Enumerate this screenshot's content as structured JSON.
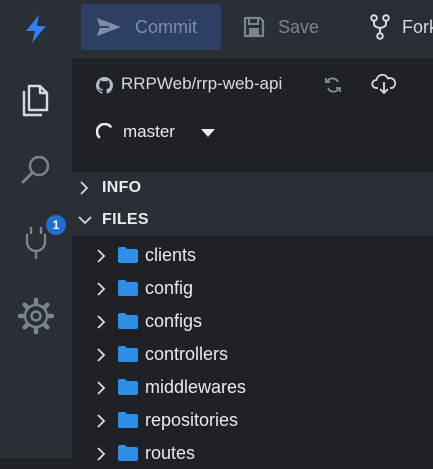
{
  "toolbar": {
    "commit_label": "Commit",
    "save_label": "Save",
    "fork_label": "Fork"
  },
  "activity": {
    "extensions_badge": "1"
  },
  "repo": {
    "name": "RRPWeb/rrp-web-api",
    "branch": "master"
  },
  "sections": {
    "info": "INFO",
    "files": "FILES"
  },
  "files": [
    {
      "label": "clients"
    },
    {
      "label": "config"
    },
    {
      "label": "configs"
    },
    {
      "label": "controllers"
    },
    {
      "label": "middlewares"
    },
    {
      "label": "repositories"
    },
    {
      "label": "routes"
    }
  ],
  "colors": {
    "accent": "#2f80ed",
    "folder": "#2f8fe6",
    "badge": "#1f6fd1",
    "commit_button_bg": "#2d3f63"
  },
  "icons": [
    "logo-bolt-icon",
    "files-icon",
    "search-icon",
    "plug-icon",
    "gear-icon",
    "send-icon",
    "save-icon",
    "fork-icon",
    "github-icon",
    "sync-icon",
    "cloud-download-icon",
    "branch-spinner-icon",
    "caret-down-icon",
    "chevron-right-icon",
    "chevron-down-icon",
    "folder-icon"
  ]
}
